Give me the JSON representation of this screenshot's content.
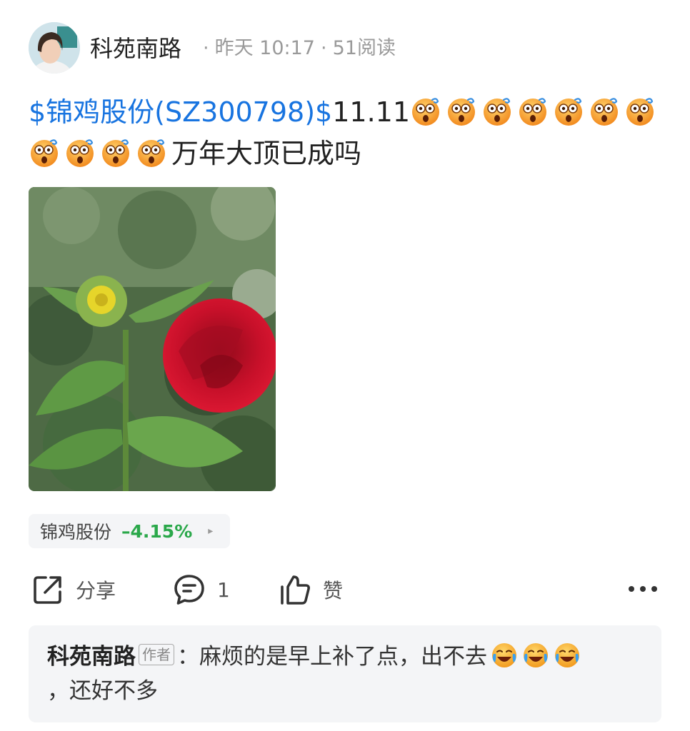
{
  "header": {
    "author": "科苑南路",
    "time": "昨天 10:17",
    "reads": "51阅读",
    "separator": "·"
  },
  "post": {
    "stock_link": "$锦鸡股份(SZ300798)$",
    "price": "11.11",
    "text_tail": "万年大顶已成吗",
    "emoji_count_line1": 7,
    "emoji_count_line2": 4,
    "emoji_icon": "dizzy-face-emoji"
  },
  "stock_chip": {
    "name": "锦鸡股份",
    "change": "–4.15%",
    "change_color": "#2aa84a",
    "arrow": "▸"
  },
  "actions": {
    "share_label": "分享",
    "comment_count": "1",
    "like_label": "赞"
  },
  "comment_preview": {
    "author": "科苑南路",
    "badge": "作者",
    "colon": "：",
    "text": "麻烦的是早上补了点，出不去",
    "text_tail": "，还好不多",
    "emoji_icon": "crying-laughing-emoji"
  },
  "colors": {
    "link": "#1874e0",
    "down_green": "#2aa84a",
    "card_bg": "#f4f5f7"
  }
}
